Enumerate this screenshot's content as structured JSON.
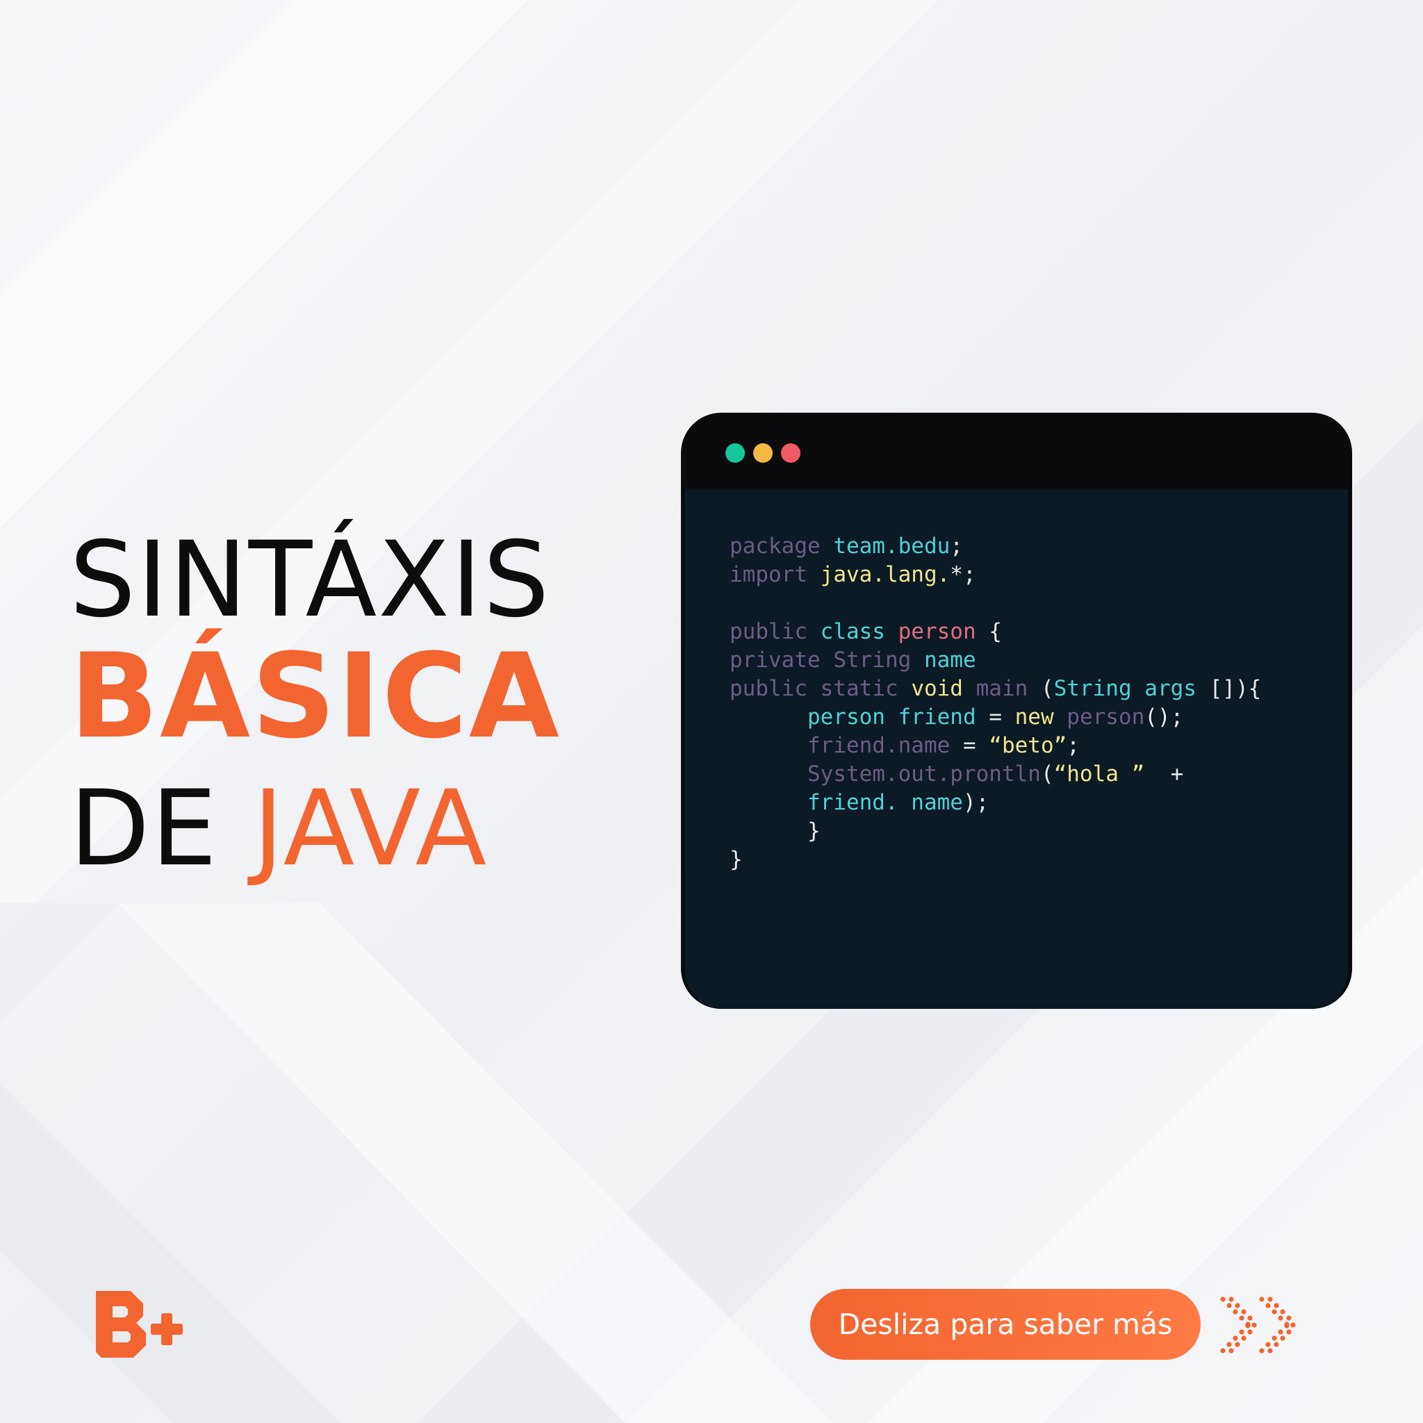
{
  "headline": {
    "line1": "SINTÁXIS",
    "line2": "BÁSICA",
    "line3_prefix": "DE",
    "line3_accent": "JAVA"
  },
  "window": {
    "dots": [
      "green",
      "yellow",
      "red"
    ]
  },
  "code": [
    [
      {
        "t": "package ",
        "c": "kw"
      },
      {
        "t": "team.bedu",
        "c": "cy"
      },
      {
        "t": ";",
        "c": "wh"
      }
    ],
    [
      {
        "t": "import ",
        "c": "kw"
      },
      {
        "t": "java.lang.",
        "c": "ye"
      },
      {
        "t": "*;",
        "c": "wh"
      }
    ],
    [],
    [
      {
        "t": "public ",
        "c": "kw"
      },
      {
        "t": "class ",
        "c": "cy"
      },
      {
        "t": "person",
        "c": "pk"
      },
      {
        "t": " {",
        "c": "wh"
      }
    ],
    [
      {
        "t": "private ",
        "c": "kw"
      },
      {
        "t": "String ",
        "c": "kw"
      },
      {
        "t": "name",
        "c": "cy"
      }
    ],
    [
      {
        "t": "public ",
        "c": "kw"
      },
      {
        "t": "static ",
        "c": "kw"
      },
      {
        "t": "void ",
        "c": "ye"
      },
      {
        "t": "main ",
        "c": "kw"
      },
      {
        "t": "(",
        "c": "wh"
      },
      {
        "t": "String ",
        "c": "cy"
      },
      {
        "t": "args",
        "c": "cy"
      },
      {
        "t": " []){",
        "c": "wh"
      }
    ],
    [
      {
        "t": "      ",
        "c": "wh"
      },
      {
        "t": "person ",
        "c": "cy"
      },
      {
        "t": "friend",
        "c": "cy"
      },
      {
        "t": " = ",
        "c": "wh"
      },
      {
        "t": "new ",
        "c": "ye"
      },
      {
        "t": "person",
        "c": "kw"
      },
      {
        "t": "();",
        "c": "wh"
      }
    ],
    [
      {
        "t": "      ",
        "c": "wh"
      },
      {
        "t": "friend.name",
        "c": "kw"
      },
      {
        "t": " = ",
        "c": "wh"
      },
      {
        "t": "“beto”",
        "c": "ye"
      },
      {
        "t": ";",
        "c": "wh"
      }
    ],
    [
      {
        "t": "      ",
        "c": "wh"
      },
      {
        "t": "System.out.prontln",
        "c": "kw"
      },
      {
        "t": "(",
        "c": "wh"
      },
      {
        "t": "“hola ”",
        "c": "ye"
      },
      {
        "t": "  +",
        "c": "wh"
      }
    ],
    [
      {
        "t": "      ",
        "c": "wh"
      },
      {
        "t": "friend. name",
        "c": "cy"
      },
      {
        "t": ");",
        "c": "wh"
      }
    ],
    [
      {
        "t": "      ",
        "c": "wh"
      },
      {
        "t": "}",
        "c": "wh"
      }
    ],
    [
      {
        "t": "}",
        "c": "wh"
      }
    ]
  ],
  "cta": {
    "label": "Desliza para saber más"
  },
  "icons": {
    "logo": "bedu-b-plus-logo",
    "arrows": "dotted-double-chevron-right-icon"
  },
  "colors": {
    "accent": "#f26430",
    "code_bg": "#0b1a24",
    "window_bar": "#0b0b0d"
  }
}
